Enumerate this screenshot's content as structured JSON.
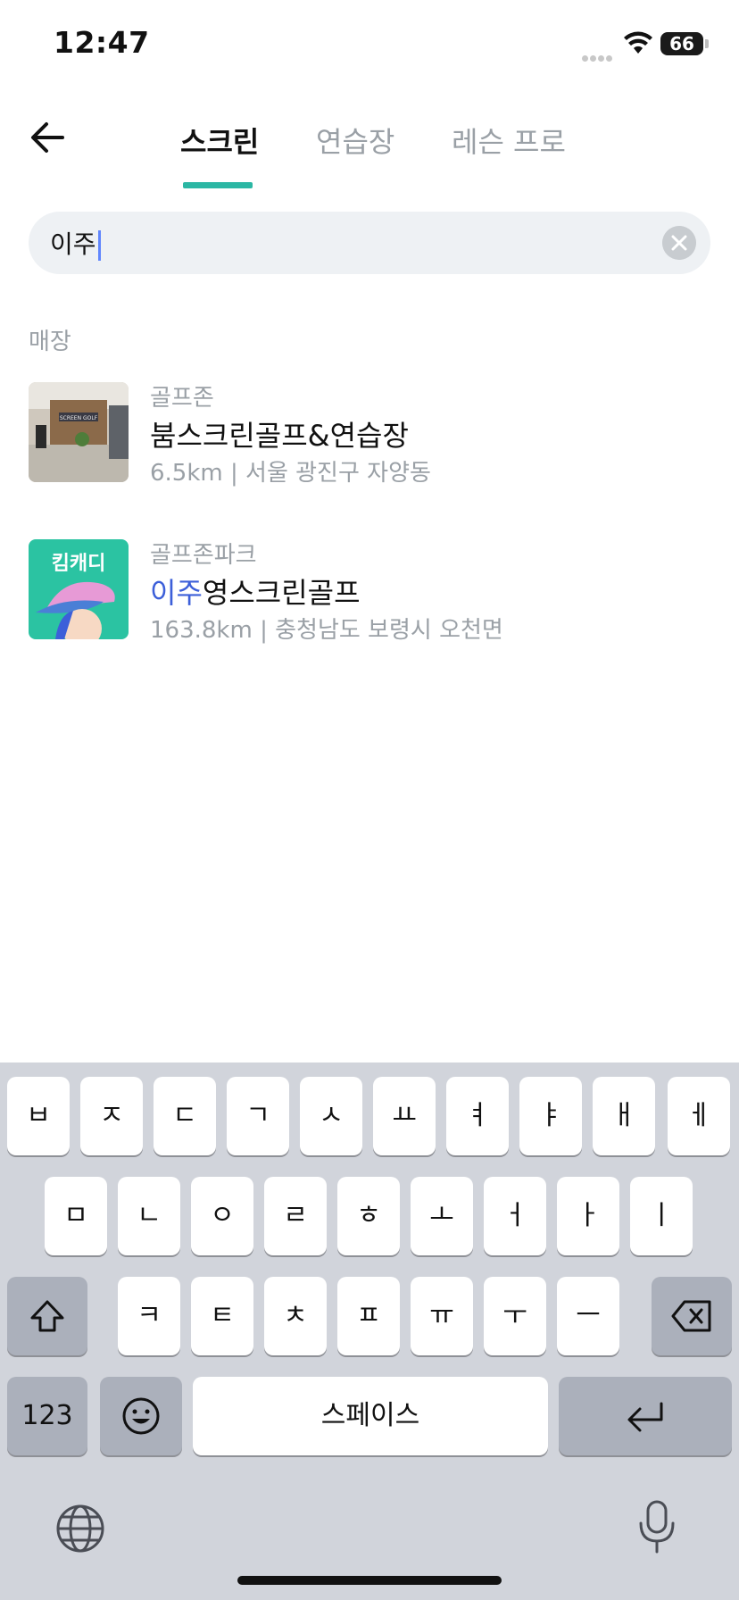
{
  "status_bar": {
    "time": "12:47",
    "battery": "66",
    "signal_icon": "signal-dots-icon",
    "wifi_icon": "wifi-icon"
  },
  "header": {
    "back_icon": "arrow-left-icon",
    "tabs": [
      {
        "label": "스크린",
        "active": true
      },
      {
        "label": "연습장",
        "active": false
      },
      {
        "label": "레슨 프로",
        "active": false
      }
    ],
    "accent_color": "#2bb7a4"
  },
  "search": {
    "value": "이주",
    "clear_icon": "clear-x-icon"
  },
  "results": {
    "section_label": "매장",
    "items": [
      {
        "brand": "골프존",
        "name_highlight": "",
        "name_rest": "붐스크린골프&연습장",
        "meta": "6.5km | 서울 광진구 자양동",
        "thumb_text": "SCREEN GOLF"
      },
      {
        "brand": "골프존파크",
        "name_highlight": "이주",
        "name_rest": "영스크린골프",
        "meta": "163.8km | 충청남도 보령시 오천면",
        "thumb_text": "킴캐디"
      }
    ],
    "highlight_color": "#3c5fd9"
  },
  "keyboard": {
    "row1": [
      "ㅂ",
      "ㅈ",
      "ㄷ",
      "ㄱ",
      "ㅅ",
      "ㅛ",
      "ㅕ",
      "ㅑ",
      "ㅐ",
      "ㅔ"
    ],
    "row2": [
      "ㅁ",
      "ㄴ",
      "ㅇ",
      "ㄹ",
      "ㅎ",
      "ㅗ",
      "ㅓ",
      "ㅏ",
      "ㅣ"
    ],
    "row3": [
      "ㅋ",
      "ㅌ",
      "ㅊ",
      "ㅍ",
      "ㅠ",
      "ㅜ",
      "ㅡ"
    ],
    "numbers_label": "123",
    "space_label": "스페이스",
    "shift_icon": "shift-icon",
    "delete_icon": "backspace-icon",
    "emoji_icon": "emoji-icon",
    "return_icon": "return-icon",
    "globe_icon": "globe-icon",
    "mic_icon": "microphone-icon"
  }
}
